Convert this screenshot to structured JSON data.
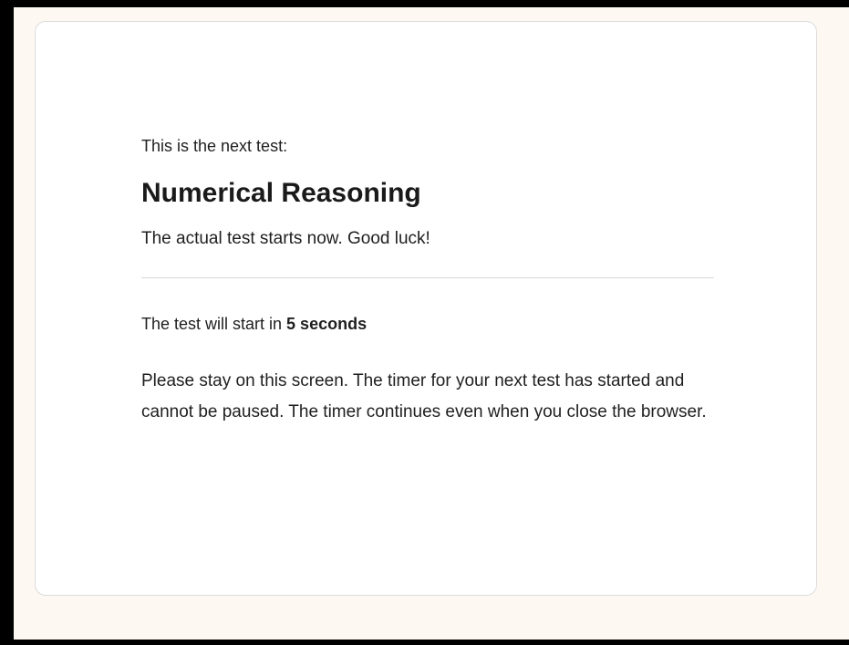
{
  "intro_text": "This is the next test:",
  "test_name": "Numerical Reasoning",
  "start_message": "The actual test starts now. Good luck!",
  "countdown": {
    "prefix": "The test will start in ",
    "value": "5 seconds"
  },
  "notice": "Please stay on this screen. The timer for your next test has started and cannot be paused. The timer continues even when you close the browser.",
  "colors": {
    "page_background": "#fef8f3",
    "card_background": "#ffffff",
    "text": "#1f1f1f"
  }
}
